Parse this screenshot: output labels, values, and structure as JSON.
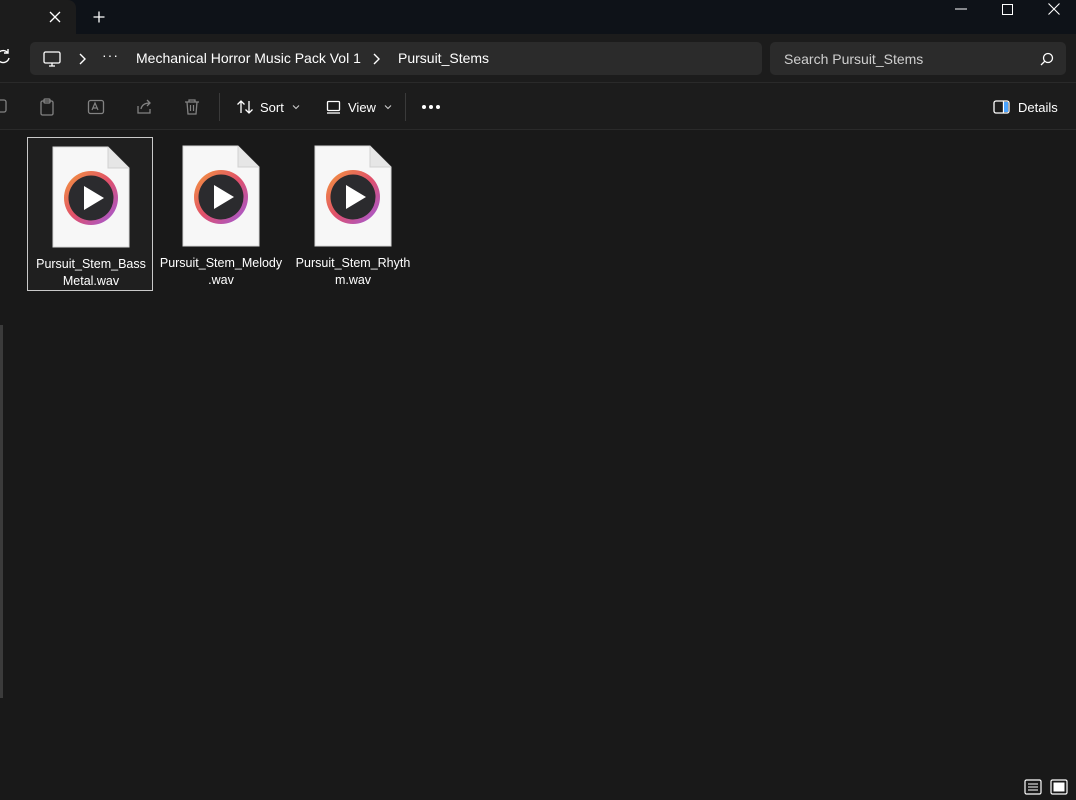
{
  "titlebar": {
    "tab_close_icon": "close-icon",
    "new_tab_icon": "plus-icon",
    "window_controls": [
      "minimize-icon",
      "maximize-icon",
      "close-icon"
    ]
  },
  "address": {
    "crumbs": [
      "Mechanical Horror Music Pack Vol 1",
      "Pursuit_Stems"
    ],
    "more": "···"
  },
  "search": {
    "placeholder": "Search Pursuit_Stems"
  },
  "toolbar": {
    "sort_label": "Sort",
    "view_label": "View",
    "details_label": "Details"
  },
  "files": [
    {
      "line1": "Pursuit_Stem_Bass",
      "line2": "Metal.wav",
      "selected": true
    },
    {
      "line1": "Pursuit_Stem_Melody",
      "line2": ".wav",
      "selected": false
    },
    {
      "line1": "Pursuit_Stem_Rhyth",
      "line2": "m.wav",
      "selected": false
    }
  ],
  "colors": {
    "background": "#191919",
    "titlebar": "#0e1218",
    "bar": "#2b2b2b",
    "play_ring_orange": "#f08a3c",
    "play_ring_purple": "#a05ad8"
  }
}
